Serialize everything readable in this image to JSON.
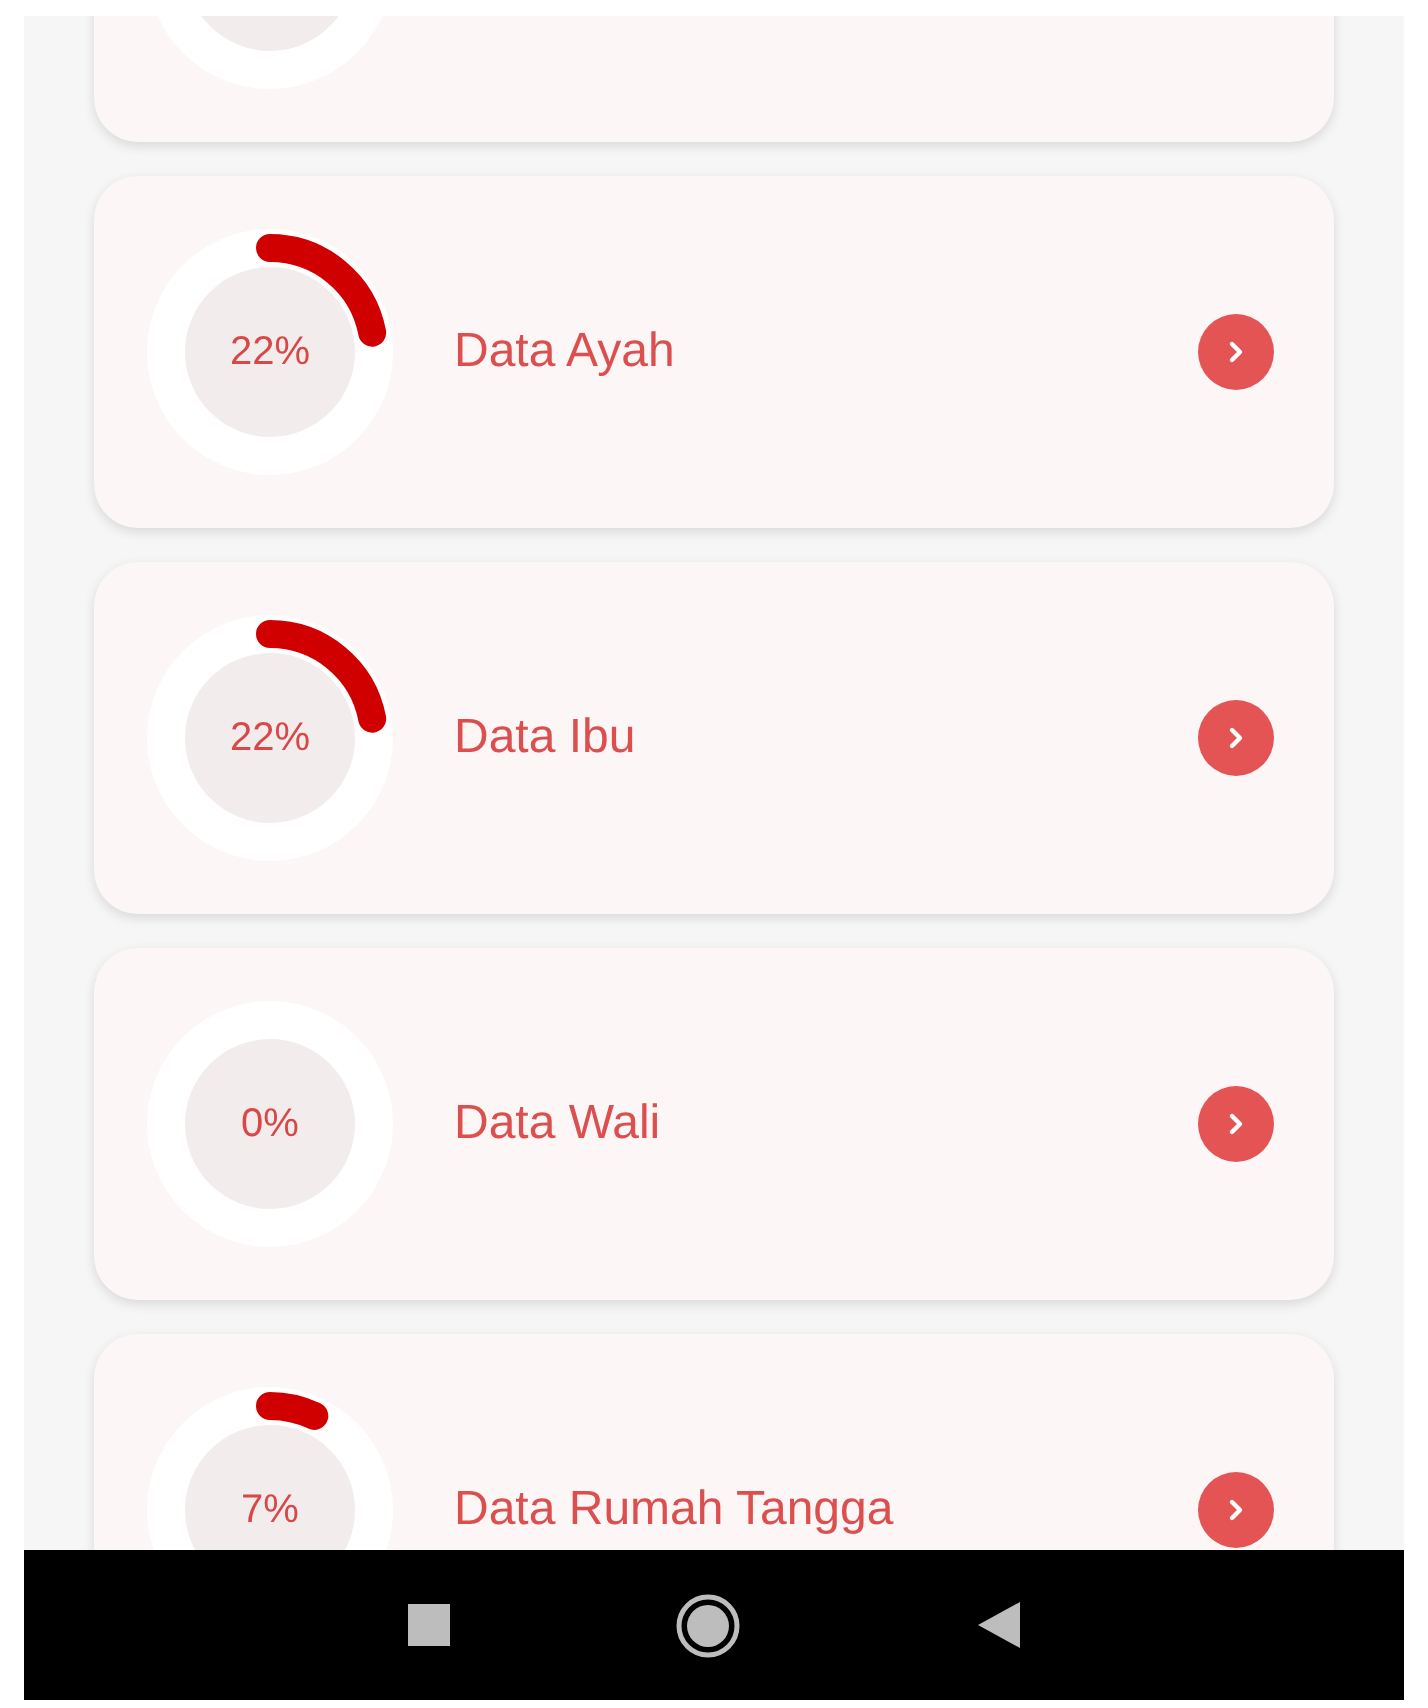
{
  "cards": [
    {
      "label": "Data Ayah",
      "reading": "22%",
      "level": 0.22
    },
    {
      "label": "Data Ibu",
      "reading": "22%",
      "level": 0.22
    },
    {
      "label": "Data Wali",
      "reading": "0%",
      "level": 0
    },
    {
      "label": "Data Rumah Tangga",
      "reading": "7%",
      "level": 0.07
    }
  ]
}
